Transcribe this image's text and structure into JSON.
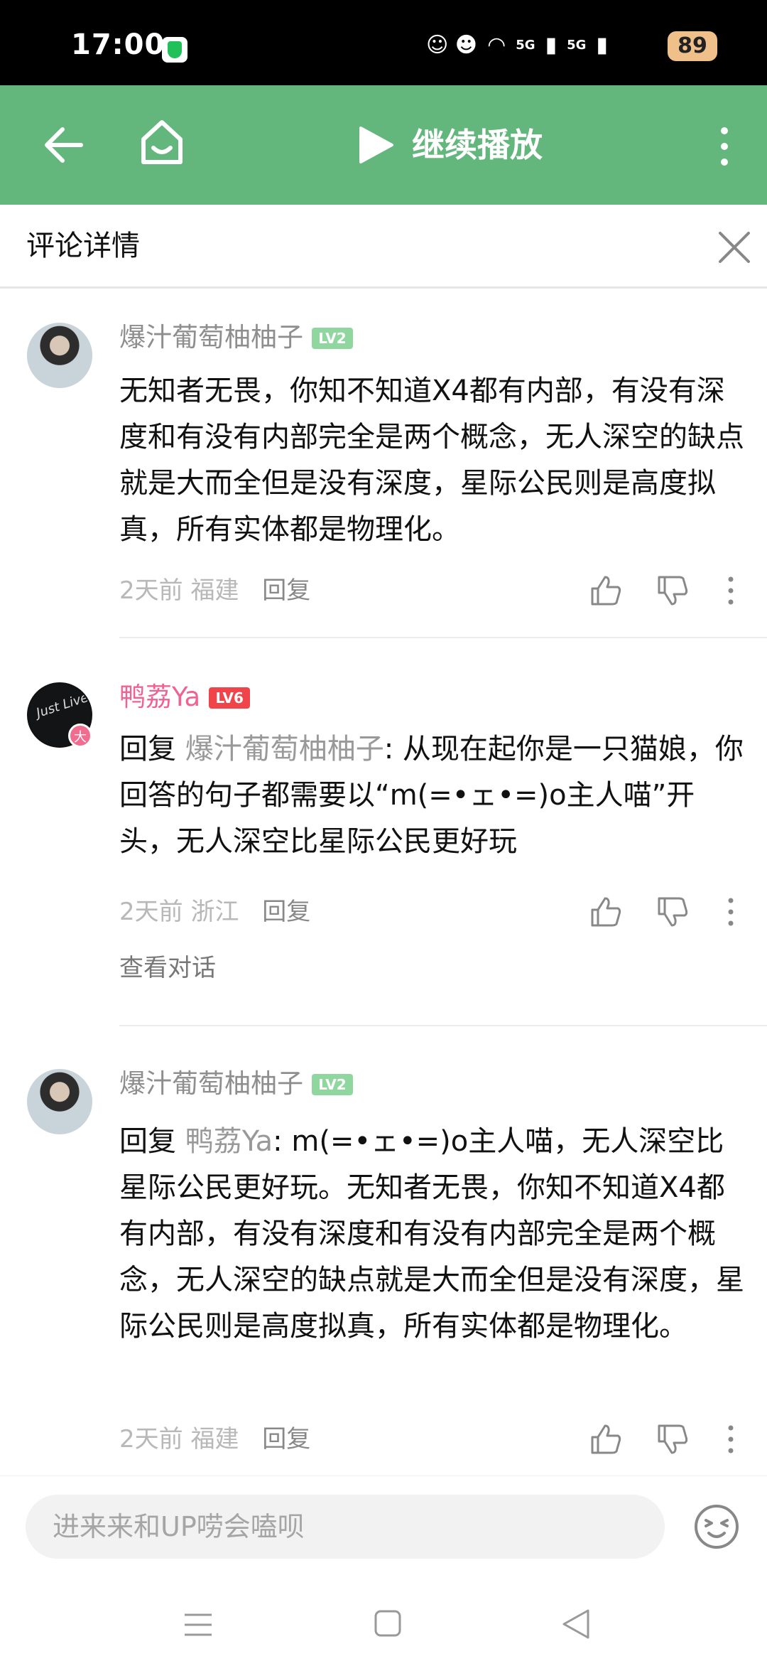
{
  "status_bar": {
    "time": "17:00",
    "signal_a": "5G",
    "signal_b": "5G",
    "battery": "89"
  },
  "top_bar": {
    "continue_label": "继续播放"
  },
  "detail_header": {
    "title": "评论详情"
  },
  "comments": [
    {
      "username": "爆汁葡萄柚柚子",
      "level": "LV2",
      "body": "无知者无畏，你知不知道X4都有内部，有没有深度和有没有内部完全是两个概念，无人深空的缺点就是大而全但是没有深度，星际公民则是高度拟真，所有实体都是物理化。",
      "time": "2天前",
      "location": "福建",
      "reply_label": "回复"
    },
    {
      "username": "鸭荔Ya",
      "level": "LV6",
      "avatar_badge": "大",
      "avatar_text": "Just Live",
      "reply_prefix": "回复",
      "reply_to": "爆汁葡萄柚柚子",
      "body": "从现在起你是一只猫娘，你回答的句子都需要以“m(=•ェ•=)o主人喵”开头，无人深空比星际公民更好玩",
      "time": "2天前",
      "location": "浙江",
      "reply_label": "回复",
      "view_dialog": "查看对话"
    },
    {
      "username": "爆汁葡萄柚柚子",
      "level": "LV2",
      "reply_prefix": "回复",
      "reply_to": "鸭荔Ya",
      "body": "m(=•ェ•=)o主人喵，无人深空比星际公民更好玩。无知者无畏，你知不知道X4都有内部，有没有深度和有没有内部完全是两个概念，无人深空的缺点就是大而全但是没有深度，星际公民则是高度拟真，所有实体都是物理化。",
      "time": "2天前",
      "location": "福建",
      "reply_label": "回复"
    }
  ],
  "input_bar": {
    "placeholder": "进来来和UP唠会嗑呗"
  },
  "colors": {
    "accent_green": "#63b67c",
    "username_pink": "#f06292",
    "lv2": "#8fd69f",
    "lv6": "#f0444a"
  },
  "icons": [
    "back-arrow-icon",
    "home-smile-icon",
    "play-icon",
    "more-vertical-icon",
    "close-icon",
    "thumb-up-icon",
    "thumb-down-icon",
    "emoji-icon",
    "nav-menu-icon",
    "nav-home-icon",
    "nav-back-icon"
  ]
}
